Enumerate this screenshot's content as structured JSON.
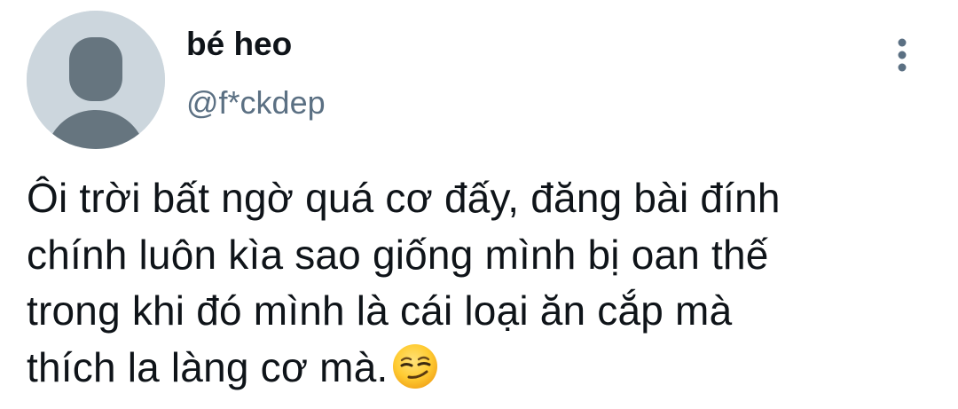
{
  "tweet": {
    "author": {
      "display_name": "bé heo",
      "handle": "@f*ckdep"
    },
    "text_lines": [
      "Ôi trời bất ngờ quá cơ đấy, đăng bài đính",
      "chính luôn kìa sao giống mình bị oan thế",
      "trong khi đó mình là cái loại ăn cắp mà",
      "thích la làng cơ mà."
    ],
    "emoji": "smirking-face"
  },
  "colors": {
    "avatar_bg": "#ccd6dd",
    "avatar_figure": "#66757f",
    "handle": "#5b7083",
    "text": "#0f1419",
    "more_icon": "#5b7083"
  },
  "icons": {
    "more": "vertical-ellipsis-icon",
    "avatar": "default-profile-icon"
  }
}
